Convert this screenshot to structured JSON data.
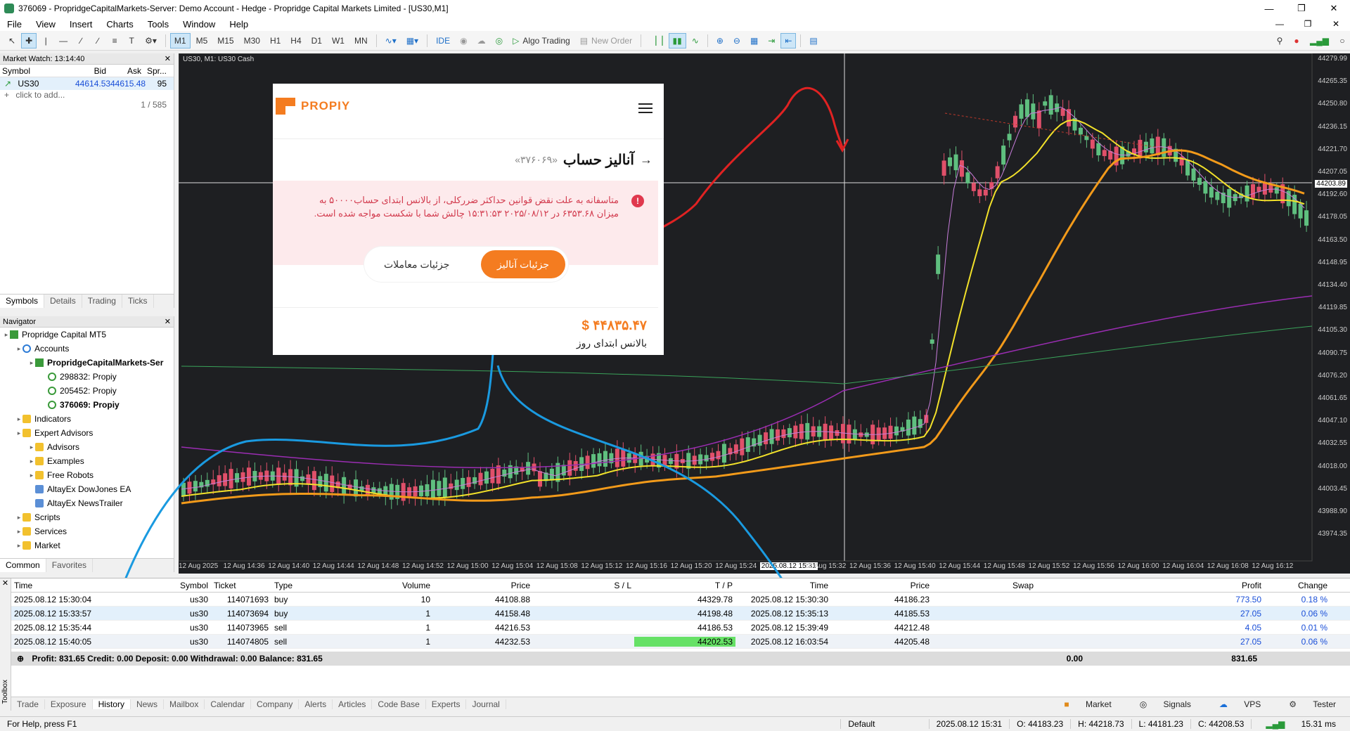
{
  "window": {
    "title": "376069 - PropridgeCapitalMarkets-Server: Demo Account - Hedge - Propridge Capital Markets Limited - [US30,M1]"
  },
  "menu": [
    "File",
    "View",
    "Insert",
    "Charts",
    "Tools",
    "Window",
    "Help"
  ],
  "toolbar": {
    "timeframes": [
      "M1",
      "M5",
      "M15",
      "M30",
      "H1",
      "H4",
      "D1",
      "W1",
      "MN"
    ],
    "ide": "IDE",
    "algo": "Algo Trading",
    "new_order": "New Order"
  },
  "market_watch": {
    "title": "Market Watch: 13:14:40",
    "cols": [
      "Symbol",
      "Bid",
      "Ask",
      "Spr..."
    ],
    "row": {
      "symbol": "US30",
      "bid": "44614.53",
      "ask": "44615.48",
      "spread": "95"
    },
    "add": "click to add...",
    "count": "1 / 585",
    "tabs": [
      "Symbols",
      "Details",
      "Trading",
      "Ticks"
    ]
  },
  "navigator": {
    "title": "Navigator",
    "items": [
      {
        "label": "Propridge Capital MT5",
        "level": 0,
        "icon": "mt5"
      },
      {
        "label": "Accounts",
        "level": 1,
        "icon": "globe"
      },
      {
        "label": "PropridgeCapitalMarkets-Ser",
        "level": 2,
        "icon": "server",
        "bold": true
      },
      {
        "label": "298832: Propiy",
        "level": 3,
        "icon": "user"
      },
      {
        "label": "205452: Propiy",
        "level": 3,
        "icon": "user"
      },
      {
        "label": "376069: Propiy",
        "level": 3,
        "icon": "user",
        "bold": true
      },
      {
        "label": "Indicators",
        "level": 1,
        "icon": "folder"
      },
      {
        "label": "Expert Advisors",
        "level": 1,
        "icon": "folder"
      },
      {
        "label": "Advisors",
        "level": 2,
        "icon": "folder"
      },
      {
        "label": "Examples",
        "level": 2,
        "icon": "folder"
      },
      {
        "label": "Free Robots",
        "level": 2,
        "icon": "folder"
      },
      {
        "label": "AltayEx DowJones EA",
        "level": 2,
        "icon": "ea"
      },
      {
        "label": "AltayEx NewsTrailer",
        "level": 2,
        "icon": "ea"
      },
      {
        "label": "Scripts",
        "level": 1,
        "icon": "folder"
      },
      {
        "label": "Services",
        "level": 1,
        "icon": "folder"
      },
      {
        "label": "Market",
        "level": 1,
        "icon": "folder"
      }
    ],
    "tabs": [
      "Common",
      "Favorites"
    ]
  },
  "chart": {
    "label": "US30, M1:  US30 Cash",
    "prices": [
      "44279.99",
      "44265.35",
      "44250.80",
      "44236.15",
      "44221.70",
      "44207.05",
      "44192.60",
      "44178.05",
      "44163.50",
      "44148.95",
      "44134.40",
      "44119.85",
      "44105.30",
      "44090.75",
      "44076.20",
      "44061.65",
      "44047.10",
      "44032.55",
      "44018.00",
      "44003.45",
      "43988.90",
      "43974.35"
    ],
    "current_price": "44203.89",
    "times": [
      "12 Aug 2025",
      "12 Aug 14:36",
      "12 Aug 14:40",
      "12 Aug 14:44",
      "12 Aug 14:48",
      "12 Aug 14:52",
      "12 Aug 15:00",
      "12 Aug 15:04",
      "12 Aug 15:08",
      "12 Aug 15:12",
      "12 Aug 15:16",
      "12 Aug 15:20",
      "12 Aug 15:24",
      "2025.08.12 15:31",
      "12 Aug 15:32",
      "12 Aug 15:36",
      "12 Aug 15:40",
      "12 Aug 15:44",
      "12 Aug 15:48",
      "12 Aug 15:52",
      "12 Aug 15:56",
      "12 Aug 16:00",
      "12 Aug 16:04",
      "12 Aug 16:08",
      "12 Aug 16:12"
    ]
  },
  "popup": {
    "brand": "PROPIY",
    "heading": "آنالیز حساب",
    "account": "«۳۷۶۰۶۹»",
    "alert": "متاسفانه به علت نقض قوانین حداکثر ضررکلی، از بالانس ابتدای حساب۵۰۰۰۰ به میزان ۶۳۵۳.۶۸ در ۲۰۲۵/۰۸/۱۲ ۱۵:۳۱:۵۳ چالش شما با شکست مواجه شده است.",
    "btn_analysis": "جزئیات آنالیز",
    "btn_trades": "جزئیات معاملات",
    "balance_value": "۴۴۸۳۵.۴۷ $",
    "balance_label": "بالانس ابتدای روز"
  },
  "history": {
    "headers": [
      "Time",
      "Symbol",
      "Ticket",
      "Type",
      "Volume",
      "Price",
      "S / L",
      "T / P",
      "Time",
      "Price",
      "Swap",
      "Profit",
      "Change"
    ],
    "rows": [
      [
        "2025.08.12 15:30:04",
        "us30",
        "114071693",
        "buy",
        "10",
        "44108.88",
        "",
        "44329.78",
        "2025.08.12 15:30:30",
        "44186.23",
        "",
        "773.50",
        "0.18 %"
      ],
      [
        "2025.08.12 15:33:57",
        "us30",
        "114073694",
        "buy",
        "1",
        "44158.48",
        "",
        "44198.48",
        "2025.08.12 15:35:13",
        "44185.53",
        "",
        "27.05",
        "0.06 %"
      ],
      [
        "2025.08.12 15:35:44",
        "us30",
        "114073965",
        "sell",
        "1",
        "44216.53",
        "",
        "44186.53",
        "2025.08.12 15:39:49",
        "44212.48",
        "",
        "4.05",
        "0.01 %"
      ],
      [
        "2025.08.12 15:40:05",
        "us30",
        "114074805",
        "sell",
        "1",
        "44232.53",
        "",
        "44202.53",
        "2025.08.12 16:03:54",
        "44205.48",
        "",
        "27.05",
        "0.06 %"
      ]
    ],
    "summary": "Profit: 831.65  Credit: 0.00  Deposit: 0.00  Withdrawal: 0.00  Balance: 831.65",
    "summary_swap": "0.00",
    "summary_profit": "831.65"
  },
  "toolbox_tabs": [
    "Trade",
    "Exposure",
    "History",
    "News",
    "Mailbox",
    "Calendar",
    "Company",
    "Alerts",
    "Articles",
    "Code Base",
    "Experts",
    "Journal"
  ],
  "toolbox_side": "Toolbox",
  "toolbox_right": [
    "Market",
    "Signals",
    "VPS",
    "Tester"
  ],
  "status": {
    "help": "For Help, press F1",
    "profile": "Default",
    "datetime": "2025.08.12 15:31",
    "open": "O: 44183.23",
    "high": "H: 44218.73",
    "low": "L: 44181.23",
    "close": "C: 44208.53",
    "ping": "15.31 ms"
  }
}
